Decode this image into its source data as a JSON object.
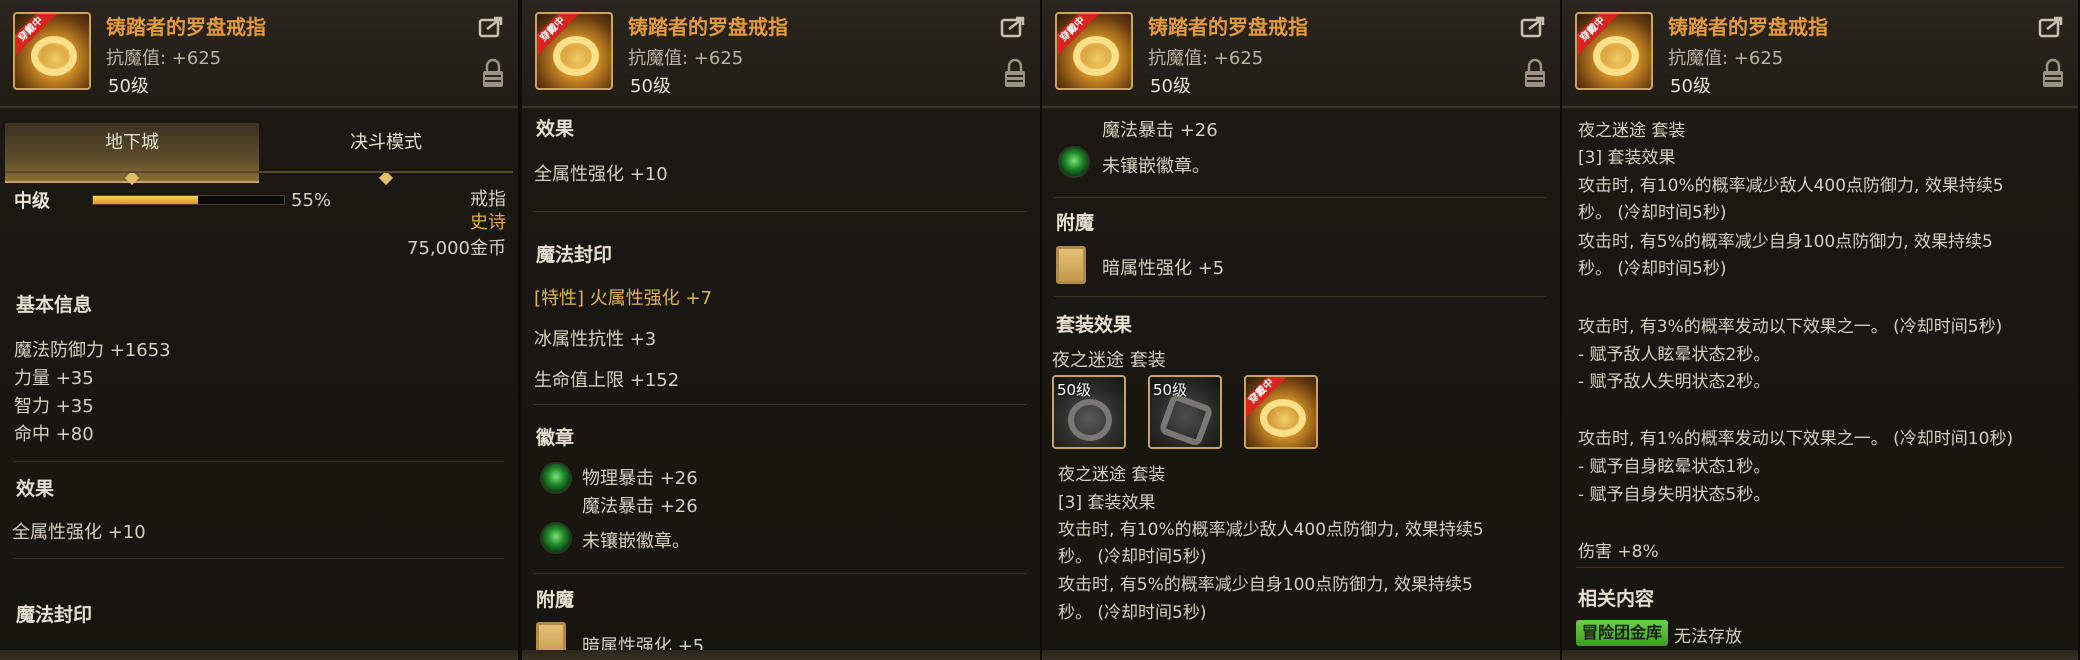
{
  "item": {
    "name": "铸踏者的罗盘戒指",
    "stat": "抗魔值: +625",
    "level": "50级",
    "icon_tag": "穿戴中",
    "icon": "compass-ring-icon"
  },
  "tabs": [
    {
      "label": "地下城"
    },
    {
      "label": "决斗模式"
    }
  ],
  "grade": {
    "label": "中级",
    "percent_text": "55%",
    "percent_value": 0.55
  },
  "meta": {
    "type": "戒指",
    "rarity": "史诗",
    "price": "75,000金币"
  },
  "basic": {
    "title": "基本信息",
    "lines": [
      "魔法防御力 +1653",
      "力量 +35",
      "智力 +35",
      "命中 +80"
    ]
  },
  "effect": {
    "title": "效果",
    "line": "全属性强化 +10"
  },
  "seal": {
    "title": "魔法封印",
    "lines": [
      "[特性] 火属性强化 +7",
      "冰属性抗性 +3",
      "生命值上限 +152"
    ]
  },
  "emblem": {
    "title": "徽章",
    "gem1_lines": [
      "物理暴击 +26",
      "魔法暴击 +26"
    ],
    "gem2_line": "未镶嵌徽章。"
  },
  "enchant": {
    "title": "附魔",
    "line": "暗属性强化 +5"
  },
  "set": {
    "title": "套装效果",
    "name_row": "夜之迷途  套装",
    "icons": [
      {
        "level": "50级"
      },
      {
        "level": "50级"
      },
      {
        "level": ""
      }
    ],
    "name_row2": "夜之迷途  套装",
    "count_label": "[3] 套装效果",
    "effect_lines": [
      "攻击时, 有10%的概率减少敌人400点防御力, 效果持续5",
      "秒。 (冷却时间5秒)",
      "攻击时, 有5%的概率减少自身100点防御力, 效果持续5",
      "秒。 (冷却时间5秒)"
    ],
    "extra_lines_a": [
      "攻击时, 有3%的概率发动以下效果之一。 (冷却时间5秒)",
      "- 赋予敌人眩晕状态2秒。",
      "- 赋予敌人失明状态2秒。"
    ],
    "extra_lines_b": [
      "攻击时, 有1%的概率发动以下效果之一。 (冷却时间10秒)",
      "- 赋予自身眩晕状态1秒。",
      "- 赋予自身失明状态5秒。"
    ],
    "damage": "伤害 +8%"
  },
  "related": {
    "title": "相关内容",
    "badge": "冒险团金库",
    "note": "无法存放"
  }
}
